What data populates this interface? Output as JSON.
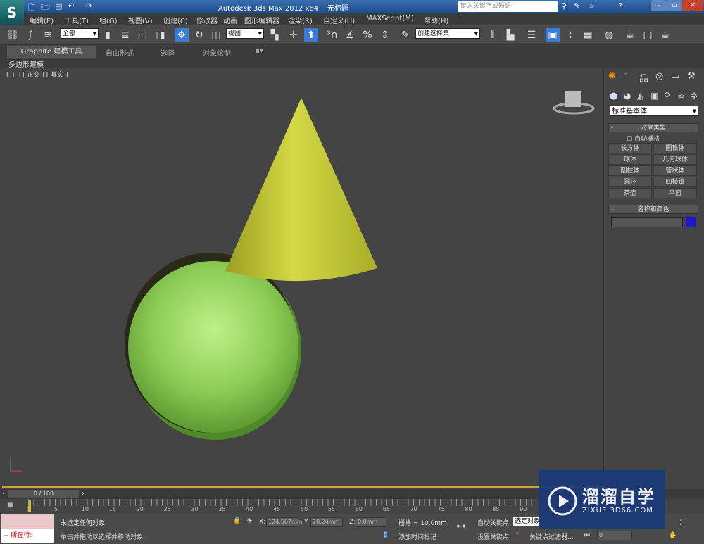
{
  "title": {
    "app": "Autodesk 3ds Max  2012 x64",
    "file": "无标题",
    "search_placeholder": "键入关键字或短语"
  },
  "menu": [
    "编辑(E)",
    "工具(T)",
    "组(G)",
    "视图(V)",
    "创建(C)",
    "修改器",
    "动画",
    "图形编辑器",
    "渲染(R)",
    "自定义(U)",
    "MAXScript(M)",
    "帮助(H)"
  ],
  "toolbar": {
    "filter": "全部",
    "refcoord": "视图",
    "selection_set": "创建选择集"
  },
  "ribbon": {
    "tabs": [
      "Graphite 建模工具",
      "自由形式",
      "选择",
      "对象绘制"
    ],
    "sub": "多边形建模"
  },
  "viewport": {
    "label": "[ + ] [ 正交 ] [ 真实 ]",
    "cone_color": "#c8cc3a",
    "sphere_color": "#8fd060"
  },
  "panel": {
    "dropdown": "标准基本体",
    "rollout1": "对象类型",
    "autogrid": "自动栅格",
    "buttons": [
      "长方体",
      "圆锥体",
      "球体",
      "几何球体",
      "圆柱体",
      "管状体",
      "圆环",
      "四棱锥",
      "茶壶",
      "平面"
    ],
    "rollout2": "名称和颜色",
    "object_color": "#1a1acc"
  },
  "timeline": {
    "frame": "0 / 100",
    "ticks": [
      "0",
      "5",
      "10",
      "15",
      "20",
      "25",
      "30",
      "35",
      "40",
      "45",
      "50",
      "55",
      "60",
      "65",
      "70",
      "75",
      "80",
      "85",
      "90"
    ]
  },
  "status": {
    "selection": "未选定任何对象",
    "prompt": "单击并拖动以选择并移动对象",
    "x_label": "X:",
    "x": "124.567mm",
    "y_label": "Y:",
    "y": "28.24mm",
    "z_label": "Z:",
    "z": "0.0mm",
    "grid": "栅格 = 10.0mm",
    "add_time_tag": "添加时间标记",
    "auto_key": "自动关键点",
    "set_key": "设置关键点",
    "selected": "选定对象",
    "key_filters": "关键点过滤器...",
    "frame_value": "0",
    "script_label": "所在行:"
  },
  "watermark": {
    "name": "溜溜自学",
    "url": "ZIXUE.3D66.COM"
  }
}
